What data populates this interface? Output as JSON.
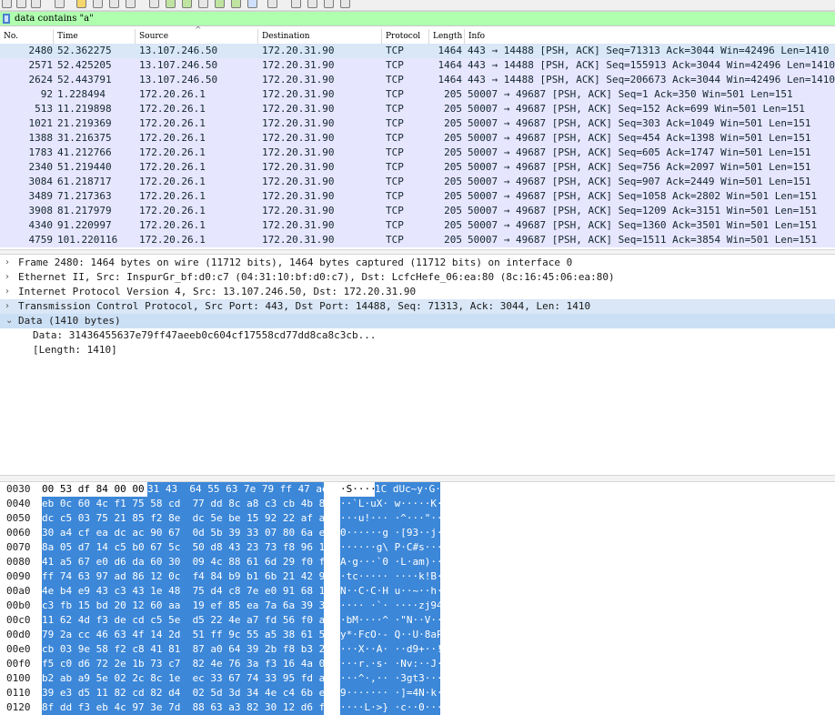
{
  "filter": {
    "value": "data contains \"a\""
  },
  "columns": [
    "No.",
    "Time",
    "Source",
    "Destination",
    "Protocol",
    "Length",
    "Info"
  ],
  "packets": [
    {
      "no": "2480",
      "time": "52.362275",
      "src": "13.107.246.50",
      "dst": "172.20.31.90",
      "proto": "TCP",
      "len": "1464",
      "info": "443 → 14488 [PSH, ACK] Seq=71313 Ack=3044 Win=42496 Len=1410"
    },
    {
      "no": "2571",
      "time": "52.425205",
      "src": "13.107.246.50",
      "dst": "172.20.31.90",
      "proto": "TCP",
      "len": "1464",
      "info": "443 → 14488 [PSH, ACK] Seq=155913 Ack=3044 Win=42496 Len=1410"
    },
    {
      "no": "2624",
      "time": "52.443791",
      "src": "13.107.246.50",
      "dst": "172.20.31.90",
      "proto": "TCP",
      "len": "1464",
      "info": "443 → 14488 [PSH, ACK] Seq=206673 Ack=3044 Win=42496 Len=1410"
    },
    {
      "no": "92",
      "time": "1.228494",
      "src": "172.20.26.1",
      "dst": "172.20.31.90",
      "proto": "TCP",
      "len": "205",
      "info": "50007 → 49687 [PSH, ACK] Seq=1 Ack=350 Win=501 Len=151"
    },
    {
      "no": "513",
      "time": "11.219898",
      "src": "172.20.26.1",
      "dst": "172.20.31.90",
      "proto": "TCP",
      "len": "205",
      "info": "50007 → 49687 [PSH, ACK] Seq=152 Ack=699 Win=501 Len=151"
    },
    {
      "no": "1021",
      "time": "21.219369",
      "src": "172.20.26.1",
      "dst": "172.20.31.90",
      "proto": "TCP",
      "len": "205",
      "info": "50007 → 49687 [PSH, ACK] Seq=303 Ack=1049 Win=501 Len=151"
    },
    {
      "no": "1388",
      "time": "31.216375",
      "src": "172.20.26.1",
      "dst": "172.20.31.90",
      "proto": "TCP",
      "len": "205",
      "info": "50007 → 49687 [PSH, ACK] Seq=454 Ack=1398 Win=501 Len=151"
    },
    {
      "no": "1783",
      "time": "41.212766",
      "src": "172.20.26.1",
      "dst": "172.20.31.90",
      "proto": "TCP",
      "len": "205",
      "info": "50007 → 49687 [PSH, ACK] Seq=605 Ack=1747 Win=501 Len=151"
    },
    {
      "no": "2340",
      "time": "51.219440",
      "src": "172.20.26.1",
      "dst": "172.20.31.90",
      "proto": "TCP",
      "len": "205",
      "info": "50007 → 49687 [PSH, ACK] Seq=756 Ack=2097 Win=501 Len=151"
    },
    {
      "no": "3084",
      "time": "61.218717",
      "src": "172.20.26.1",
      "dst": "172.20.31.90",
      "proto": "TCP",
      "len": "205",
      "info": "50007 → 49687 [PSH, ACK] Seq=907 Ack=2449 Win=501 Len=151"
    },
    {
      "no": "3489",
      "time": "71.217363",
      "src": "172.20.26.1",
      "dst": "172.20.31.90",
      "proto": "TCP",
      "len": "205",
      "info": "50007 → 49687 [PSH, ACK] Seq=1058 Ack=2802 Win=501 Len=151"
    },
    {
      "no": "3908",
      "time": "81.217979",
      "src": "172.20.26.1",
      "dst": "172.20.31.90",
      "proto": "TCP",
      "len": "205",
      "info": "50007 → 49687 [PSH, ACK] Seq=1209 Ack=3151 Win=501 Len=151"
    },
    {
      "no": "4340",
      "time": "91.220997",
      "src": "172.20.26.1",
      "dst": "172.20.31.90",
      "proto": "TCP",
      "len": "205",
      "info": "50007 → 49687 [PSH, ACK] Seq=1360 Ack=3501 Win=501 Len=151"
    },
    {
      "no": "4759",
      "time": "101.220116",
      "src": "172.20.26.1",
      "dst": "172.20.31.90",
      "proto": "TCP",
      "len": "205",
      "info": "50007 → 49687 [PSH, ACK] Seq=1511 Ack=3854 Win=501 Len=151"
    }
  ],
  "details": [
    {
      "arrow": "›",
      "text": "Frame 2480: 1464 bytes on wire (11712 bits), 1464 bytes captured (11712 bits) on interface 0"
    },
    {
      "arrow": "›",
      "text": "Ethernet II, Src: InspurGr_bf:d0:c7 (04:31:10:bf:d0:c7), Dst: LcfcHefe_06:ea:80 (8c:16:45:06:ea:80)"
    },
    {
      "arrow": "›",
      "text": "Internet Protocol Version 4, Src: 13.107.246.50, Dst: 172.20.31.90"
    },
    {
      "arrow": "›",
      "text": "Transmission Control Protocol, Src Port: 443, Dst Port: 14488, Seq: 71313, Ack: 3044, Len: 1410"
    },
    {
      "arrow": "⌄",
      "text": "Data (1410 bytes)"
    },
    {
      "arrow": "",
      "text": "Data: 31436455637e79ff47aeeb0c604cf17558cd77dd8ca8c3cb..."
    },
    {
      "arrow": "",
      "text": "[Length: 1410]"
    }
  ],
  "bytes_rows": [
    {
      "off": "0030",
      "pre": "00 53 df 84 00 00",
      "hex": "31 43  64 55 63 7e 79 ff 47 ae",
      "apre": "·S····",
      "ascii": "1C dUc~y·G·"
    },
    {
      "off": "0040",
      "pre": "",
      "hex": "eb 0c 60 4c f1 75 58 cd  77 dd 8c a8 c3 cb 4b 8d",
      "apre": "",
      "ascii": "··`L·uX· w·····K·"
    },
    {
      "off": "0050",
      "pre": "",
      "hex": "dc c5 03 75 21 85 f2 8e  dc 5e be 15 92 22 af ab",
      "apre": "",
      "ascii": "···u!··· ·^···\"··"
    },
    {
      "off": "0060",
      "pre": "",
      "hex": "30 a4 cf ea dc ac 90 67  0d 5b 39 33 07 80 6a e9",
      "apre": "",
      "ascii": "0······g ·[93··j·"
    },
    {
      "off": "0070",
      "pre": "",
      "hex": "8a 05 d7 14 c5 b0 67 5c  50 d8 43 23 73 f8 96 1d",
      "apre": "",
      "ascii": "······g\\ P·C#s···"
    },
    {
      "off": "0080",
      "pre": "",
      "hex": "41 a5 67 e0 d6 da 60 30  09 4c 88 61 6d 29 f0 f9",
      "apre": "",
      "ascii": "A·g···`0 ·L·am)··"
    },
    {
      "off": "0090",
      "pre": "",
      "hex": "ff 74 63 97 ad 86 12 0c  f4 84 b9 b1 6b 21 42 93",
      "apre": "",
      "ascii": "·tc····· ····k!B·"
    },
    {
      "off": "00a0",
      "pre": "",
      "hex": "4e b4 e9 43 c3 43 1e 48  75 d4 c8 7e e0 91 68 10",
      "apre": "",
      "ascii": "N··C·C·H u··~··h·"
    },
    {
      "off": "00b0",
      "pre": "",
      "hex": "c3 fb 15 bd 20 12 60 aa  19 ef 85 ea 7a 6a 39 34",
      "apre": "",
      "ascii": "···· ·`· ····zj94"
    },
    {
      "off": "00c0",
      "pre": "",
      "hex": "11 62 4d f3 de cd c5 5e  d5 22 4e a7 fd 56 f0 a6",
      "apre": "",
      "ascii": "·bM····^ ·\"N··V··"
    },
    {
      "off": "00d0",
      "pre": "",
      "hex": "79 2a cc 46 63 4f 14 2d  51 ff 9c 55 a5 38 61 50",
      "apre": "",
      "ascii": "y*·FcO·- Q··U·8aP"
    },
    {
      "off": "00e0",
      "pre": "",
      "hex": "cb 03 9e 58 f2 c8 41 81  87 a0 64 39 2b f8 b3 21",
      "apre": "",
      "ascii": "···X··A· ··d9+··!"
    },
    {
      "off": "00f0",
      "pre": "",
      "hex": "f5 c0 d6 72 2e 1b 73 c7  82 4e 76 3a f3 16 4a 09",
      "apre": "",
      "ascii": "···r.·s· ·Nv:··J·"
    },
    {
      "off": "0100",
      "pre": "",
      "hex": "b2 ab a9 5e 02 2c 8c 1e  ec 33 67 74 33 95 fd ac",
      "apre": "",
      "ascii": "···^·,·· ·3gt3···"
    },
    {
      "off": "0110",
      "pre": "",
      "hex": "39 e3 d5 11 82 cd 82 d4  02 5d 3d 34 4e c4 6b ee",
      "apre": "",
      "ascii": "9······· ·]=4N·k·"
    },
    {
      "off": "0120",
      "pre": "",
      "hex": "8f dd f3 eb 4c 97 3e 7d  88 63 a3 82 30 12 d6 f9",
      "apre": "",
      "ascii": "····L·>} ·c··0···"
    }
  ],
  "icons": [
    "stop-capture-icon",
    "restart-icon",
    "options-icon",
    "open-icon",
    "save-icon",
    "close-icon",
    "reload-icon",
    "find-icon",
    "back-icon",
    "forward-icon",
    "goto-icon",
    "first-icon",
    "last-icon",
    "autoscroll-icon",
    "colorize-icon",
    "zoom-in-icon",
    "zoom-out-icon",
    "normal-size-icon",
    "resize-columns-icon"
  ],
  "colors": {
    "filter_ok": "#afffaf",
    "row_tcp": "#e7e6ff",
    "selection": "#3c87d8"
  }
}
